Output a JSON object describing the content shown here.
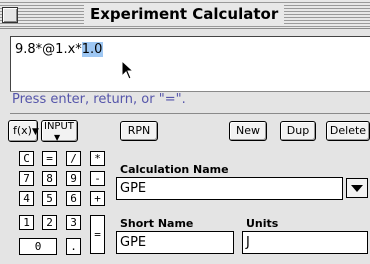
{
  "window": {
    "title": "Experiment Calculator"
  },
  "expression": {
    "text_before": "9.8*@1.x*",
    "selected_text": "1.0"
  },
  "status_hint": "Press enter, return, or \"=\".",
  "toolbar": {
    "function_menu_label": "f(x)",
    "input_menu_label": "INPUT",
    "rpn_label": "RPN",
    "new_label": "New",
    "dup_label": "Dup",
    "delete_label": "Delete"
  },
  "keypad": {
    "rows": [
      [
        "C",
        "=",
        "/",
        "*"
      ],
      [
        "7",
        "8",
        "9",
        "-"
      ],
      [
        "4",
        "5",
        "6",
        "+"
      ],
      [
        "1",
        "2",
        "3",
        "="
      ],
      [
        "0",
        "."
      ]
    ]
  },
  "calculation": {
    "name_label": "Calculation Name",
    "name_value": "GPE",
    "short_name_label": "Short Name",
    "short_name_value": "GPE",
    "units_label": "Units",
    "units_value": "J"
  },
  "icons": {
    "close": "close-box-icon",
    "cursor": "arrow-cursor-icon",
    "popup": "triangle-down-icon"
  }
}
